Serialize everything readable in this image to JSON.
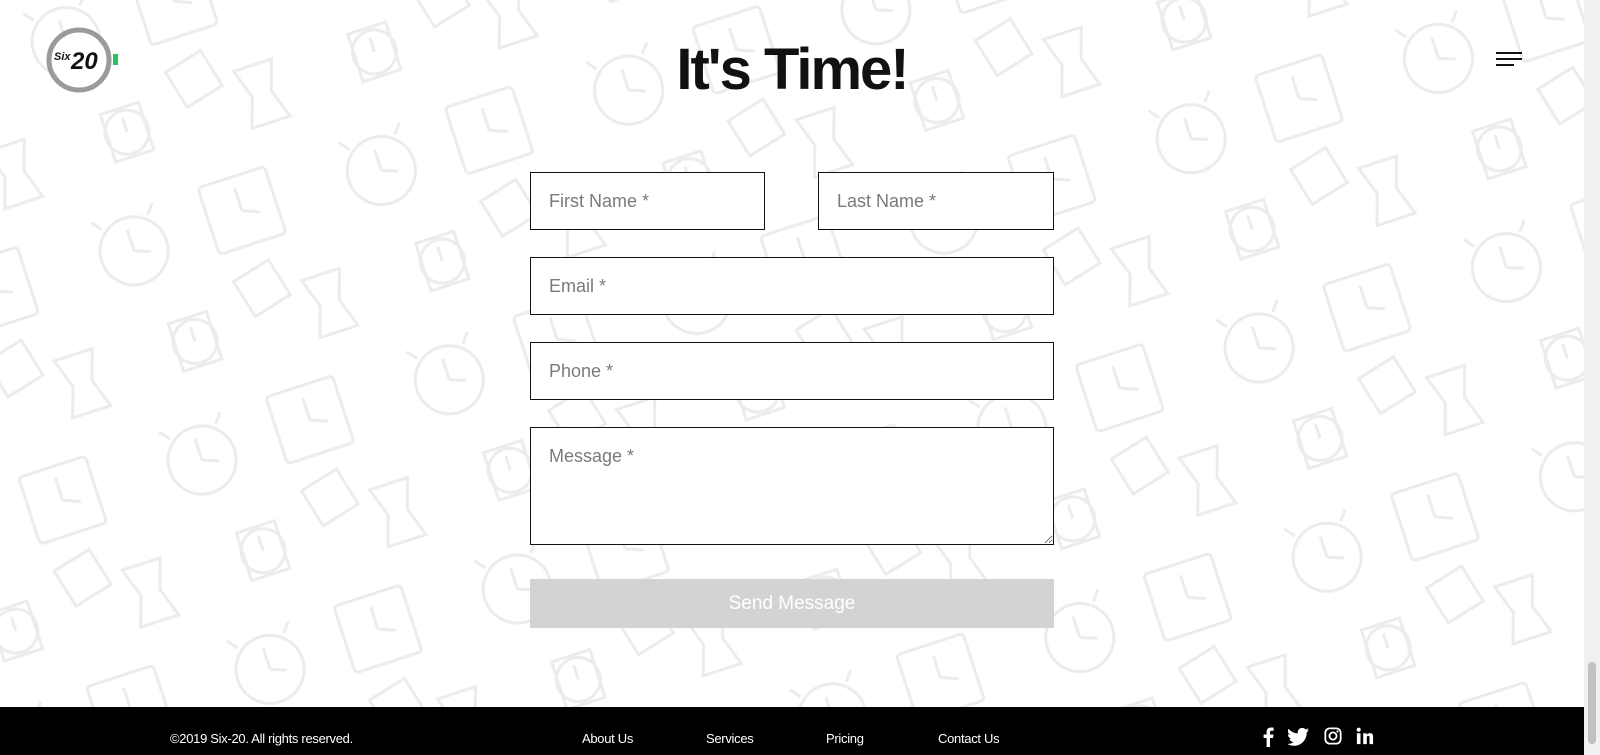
{
  "header": {
    "logo": {
      "text_small": "Six",
      "text_large": "20",
      "accent_color": "#22c55e"
    },
    "title": "It's Time!",
    "menu_icon": "hamburger-menu-icon"
  },
  "form": {
    "first_name_placeholder": "First Name *",
    "last_name_placeholder": "Last Name *",
    "email_placeholder": "Email *",
    "phone_placeholder": "Phone *",
    "message_placeholder": "Message *",
    "submit_label": "Send Message",
    "submit_color": "#d3d3d3"
  },
  "footer": {
    "copyright": "©2019 Six-20. All rights reserved.",
    "nav": [
      "About Us",
      "Services",
      "Pricing",
      "Contact Us"
    ],
    "social_icons": [
      "facebook-icon",
      "twitter-icon",
      "instagram-icon",
      "linkedin-icon"
    ],
    "background_color": "#000000"
  },
  "background": {
    "pattern": "clock-icons-pattern",
    "pattern_color": "#ececec"
  }
}
